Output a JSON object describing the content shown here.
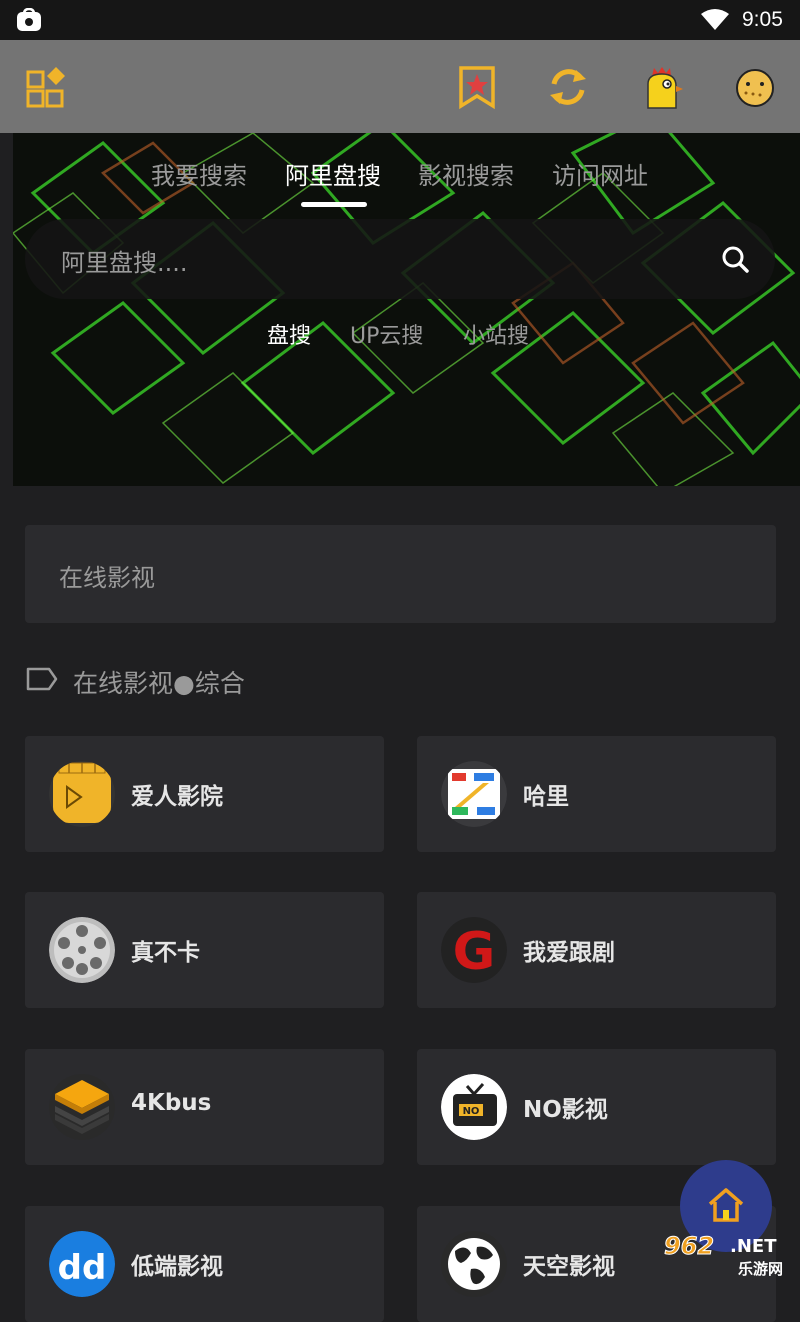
{
  "status_bar": {
    "time": "9:05"
  },
  "toolbar": {
    "icons": [
      "grid-diamond-icon",
      "bookmark-star-icon",
      "refresh-icon",
      "chick-icon",
      "cookie-face-icon"
    ]
  },
  "tabs": {
    "items": [
      "我要搜索",
      "阿里盘搜",
      "影视搜索",
      "访问网址"
    ],
    "active": "阿里盘搜"
  },
  "search": {
    "placeholder": "阿里盘搜...."
  },
  "subtabs": {
    "items": [
      "盘搜",
      "UP云搜",
      "小站搜"
    ],
    "active": "盘搜"
  },
  "online_box": {
    "label": "在线影视"
  },
  "section": {
    "title": "在线影视●综合"
  },
  "sites": [
    {
      "name": "爱人影院",
      "icon": "play-calendar-icon"
    },
    {
      "name": "哈里",
      "icon": "z-logo-icon"
    },
    {
      "name": "真不卡",
      "icon": "film-reel-icon"
    },
    {
      "name": "我爱跟剧",
      "icon": "g-logo-icon"
    },
    {
      "name": "4Kbus",
      "icon": "layers-icon"
    },
    {
      "name": "NO影视",
      "icon": "tv-no-icon"
    },
    {
      "name": "低端影视",
      "icon": "dd-logo-icon"
    },
    {
      "name": "天空影视",
      "icon": "globe-icon"
    }
  ],
  "watermark": {
    "text_top": "962.NET",
    "text_bottom": "乐游网"
  },
  "colors": {
    "toolbar": "#747474",
    "background": "#1f1f21",
    "card": "#2b2b2e",
    "accent_yellow": "#f0b429",
    "fab": "#2e3c8c"
  }
}
